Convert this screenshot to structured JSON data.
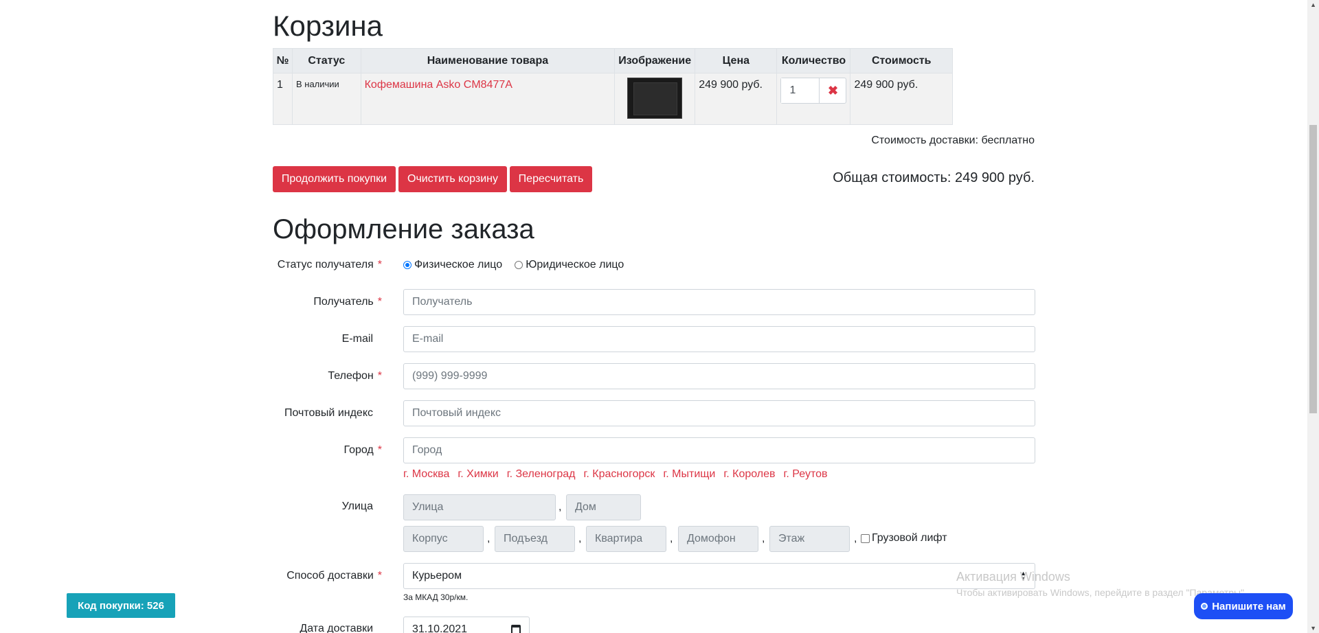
{
  "cart": {
    "title": "Корзина",
    "headers": [
      "№",
      "Статус",
      "Наименование товара",
      "Изображение",
      "Цена",
      "Количество",
      "Стоимость"
    ],
    "rows": [
      {
        "num": "1",
        "status": "В наличии",
        "name": "Кофемашина Asko CM8477A",
        "price": "249 900 руб.",
        "qty": "1",
        "cost": "249 900 руб."
      }
    ],
    "delivery_cost": "Стоимость доставки: бесплатно",
    "buttons": {
      "continue": "Продолжить покупки",
      "clear": "Очистить корзину",
      "recalc": "Пересчитать"
    },
    "total": "Общая стоимость: 249 900 руб."
  },
  "order": {
    "title": "Оформление заказа",
    "labels": {
      "status": "Статус получателя",
      "recipient": "Получатель",
      "email": "E-mail",
      "phone": "Телефон",
      "zip": "Почтовый индекс",
      "city": "Город",
      "street": "Улица",
      "delivery": "Способ доставки",
      "date": "Дата доставки"
    },
    "required_mark": "*",
    "radio": {
      "individual": "Физическое лицо",
      "legal": "Юридическое лицо"
    },
    "placeholders": {
      "recipient": "Получатель",
      "email": "E-mail",
      "phone": "(999) 999-9999",
      "zip": "Почтовый индекс",
      "city": "Город",
      "street": "Улица",
      "house": "Дом",
      "building": "Корпус",
      "entrance": "Подъезд",
      "apartment": "Квартира",
      "intercom": "Домофон",
      "floor": "Этаж"
    },
    "cities": [
      "г. Москва",
      "г. Химки",
      "г. Зеленоград",
      "г. Красногорск",
      "г. Мытищи",
      "г. Королев",
      "г. Реутов"
    ],
    "comma": ",",
    "freight_lift": "Грузовой лифт",
    "delivery_value": "Курьером",
    "delivery_hint": "За МКАД 30р/км.",
    "date_value": "31.10.2021"
  },
  "widgets": {
    "purchase_code": "Код покупки: 526",
    "chat": "Напишите нам",
    "activation_title": "Активация Windows",
    "activation_text": "Чтобы активировать Windows, перейдите в раздел \"Параметры\"."
  },
  "colors": {
    "accent": "#dc3545",
    "info": "#17a2b8",
    "chat": "#1d4ff5"
  }
}
